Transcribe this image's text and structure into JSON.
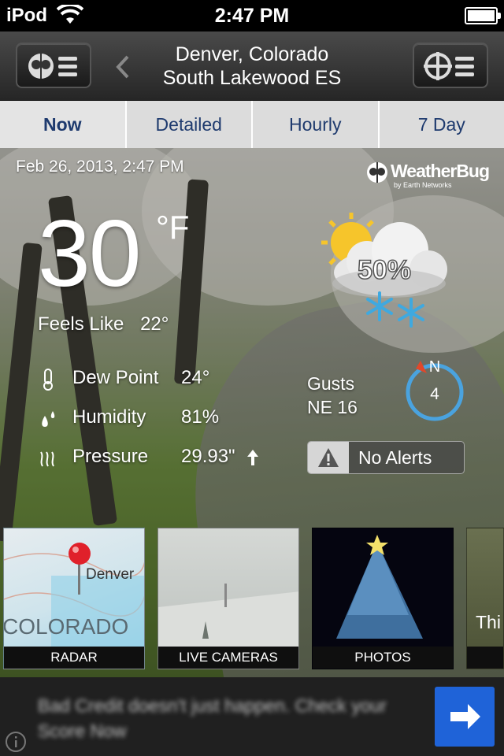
{
  "status_bar": {
    "carrier": "iPod",
    "time": "2:47 PM"
  },
  "header": {
    "city": "Denver, Colorado",
    "station": "South Lakewood ES"
  },
  "tabs": [
    {
      "label": "Now",
      "active": true
    },
    {
      "label": "Detailed",
      "active": false
    },
    {
      "label": "Hourly",
      "active": false
    },
    {
      "label": "7 Day",
      "active": false
    }
  ],
  "observation": {
    "datetime": "Feb 26, 2013, 2:47 PM",
    "brand": "WeatherBug",
    "brand_sub": "by Earth Networks",
    "temperature": "30",
    "unit": "°F",
    "feels_like_label": "Feels Like",
    "feels_like_value": "22°",
    "precip_chance": "50%"
  },
  "stats": [
    {
      "label": "Dew Point",
      "value": "24°",
      "icon": "thermometer-icon"
    },
    {
      "label": "Humidity",
      "value": "81%",
      "icon": "droplets-icon"
    },
    {
      "label": "Pressure",
      "value": "29.93\"",
      "icon": "pressure-icon",
      "trend": "up-arrow-icon"
    }
  ],
  "wind": {
    "gusts_label": "Gusts",
    "gusts_value": "NE 16",
    "compass_dir": "N",
    "speed": "4"
  },
  "alerts": {
    "label": "No Alerts"
  },
  "tiles": [
    {
      "label": "RADAR",
      "map_label": "Denver",
      "region": "COLORADO"
    },
    {
      "label": "LIVE CAMERAS"
    },
    {
      "label": "PHOTOS"
    },
    {
      "label": "Thi"
    }
  ],
  "ad": {
    "text": "Bad Credit doesn't just happen. Check your Score Now"
  },
  "colors": {
    "tab_text": "#1e3a6e",
    "compass_ring": "#4aa3df",
    "compass_needle": "#e0482b",
    "ad_button": "#1f63d8"
  }
}
